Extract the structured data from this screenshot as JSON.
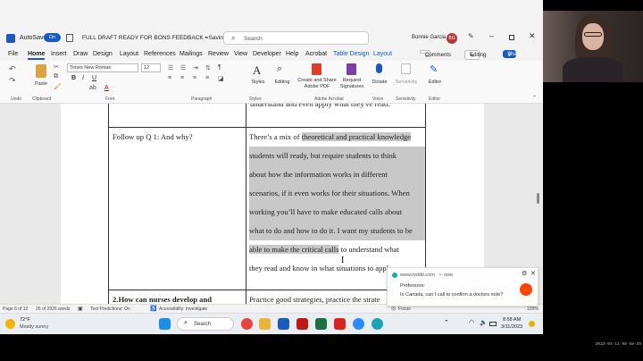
{
  "titlebar": {
    "autosave_label": "AutoSave",
    "autosave_state": "On",
    "doc_title": "FULL DRAFT READY FOR BONS FEEDBACK • Saving...",
    "search_placeholder": "Search",
    "user_name": "Bonnie Garcia",
    "user_initials": "BG"
  },
  "tabs": [
    "File",
    "Home",
    "Insert",
    "Draw",
    "Design",
    "Layout",
    "References",
    "Mailings",
    "Review",
    "View",
    "Developer",
    "Help",
    "Acrobat",
    "Table Design",
    "Layout"
  ],
  "actions": {
    "comments": "Comments",
    "editing": "Editing",
    "share": "Share"
  },
  "ribbon": {
    "undo": "Undo",
    "paste": "Paste",
    "clipboard": "Clipboard",
    "font_name": "Times New Roman",
    "font_size": "12",
    "font": "Font",
    "paragraph": "Paragraph",
    "styles": "Styles",
    "editing": "Editing",
    "create_share": "Create and Share",
    "adobe_pdf": "Adobe PDF",
    "request": "Request",
    "signatures": "Signatures",
    "adobe_acrobat": "Adobe Acrobat",
    "dictate": "Dictate",
    "voice": "Voice",
    "sensitivity": "Sensitivity",
    "editor": "Editor",
    "bold": "B",
    "italic": "I",
    "underline": "U"
  },
  "document": {
    "top_right_text": "understand and even apply what they've read.",
    "q1_label": "Follow up Q 1: And why?",
    "answer_lines": [
      "There’s a mix of theoretical and practical knowledge",
      "students will ready, but require students to think",
      "about how the information works in different",
      "scenarios, if it even works for their situations. When",
      "working you’ll have to make educated calls about",
      "what to do and how to do it. I want my students to be",
      "able to make the critical calls to understand what",
      "they read and know in what situations to apply"
    ],
    "q2_label": "2.How can nurses develop and",
    "q2_answer": "Practice good strategies, practice the strate"
  },
  "statusbar": {
    "page": "Page 6 of 12",
    "words": "26 of 2926 words",
    "text_predictions": "Text Predictions: On",
    "accessibility": "Accessibility: Investigate",
    "focus": "Focus",
    "zoom": "120%"
  },
  "notification": {
    "source": "www.reddit.com",
    "time": "now",
    "title": "Professors:",
    "body": "In Canada, can I call to confirm a doctors note?"
  },
  "taskbar": {
    "temp": "72°F",
    "weather": "Mostly sunny",
    "search": "Search",
    "time": "8:58 AM",
    "date": "3/11/2023"
  },
  "overlay": {
    "stamp": "2023-03-11 08-58-39"
  }
}
